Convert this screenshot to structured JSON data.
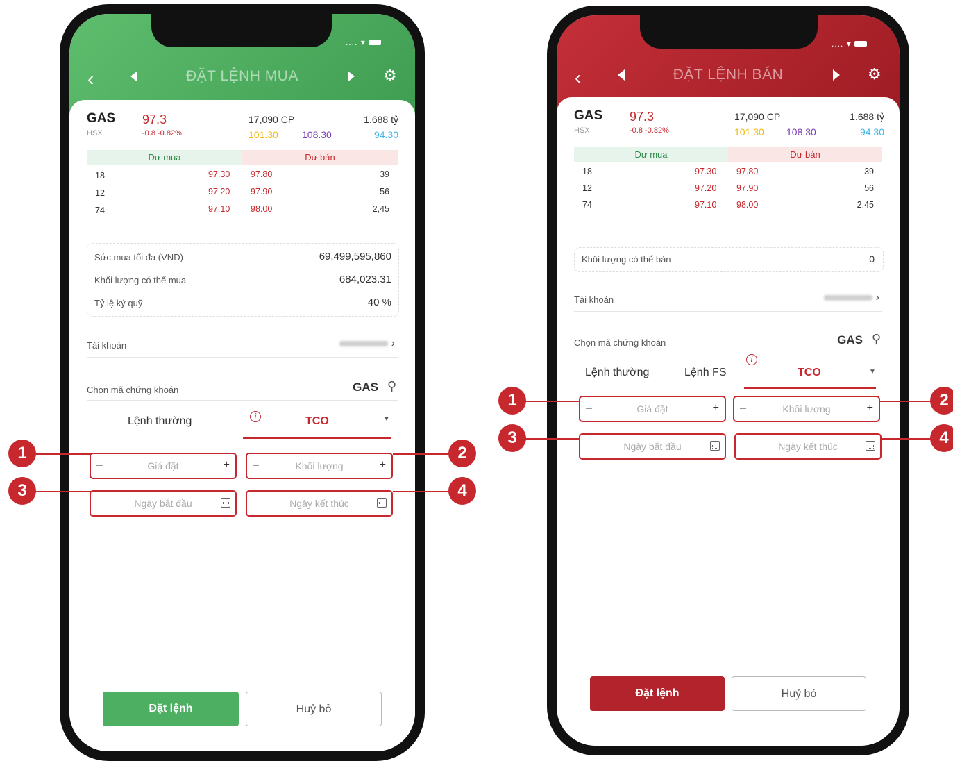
{
  "buy": {
    "status_dots": "....",
    "title": "ĐẶT LỆNH MUA",
    "stock": {
      "symbol": "GAS",
      "exchange": "HSX",
      "price": "97.3",
      "change": "-0.8  -0.82%",
      "volume": "17,090  CP",
      "value": "1.688  tỷ",
      "ref": "101.30",
      "ceiling": "108.30",
      "floor": "94.30"
    },
    "depth": {
      "buy_label": "Dư mua",
      "sell_label": "Dư bán",
      "rows": [
        {
          "bvol": "18",
          "bprice": "97.30",
          "sprice": "97.80",
          "svol": "39"
        },
        {
          "bvol": "12",
          "bprice": "97.20",
          "sprice": "97.90",
          "svol": "56"
        },
        {
          "bvol": "74",
          "bprice": "97.10",
          "sprice": "98.00",
          "svol": "2,45"
        }
      ]
    },
    "info": [
      {
        "label": "Sức mua tối đa (VND)",
        "value": "69,499,595,860"
      },
      {
        "label": "Khối lượng có thể mua",
        "value": "684,023.31"
      },
      {
        "label": "Tỷ lệ ký quỹ",
        "value": "40 %"
      }
    ],
    "account_label": "Tài khoản",
    "stock_select_label": "Chọn mã chứng khoán",
    "stock_select_value": "GAS",
    "tabs": [
      "Lệnh thường",
      "TCO"
    ],
    "price_placeholder": "Giá đặt",
    "qty_placeholder": "Khối lượng",
    "start_placeholder": "Ngày bắt đầu",
    "end_placeholder": "Ngày kết thúc",
    "submit": "Đặt lệnh",
    "cancel": "Huỷ bỏ",
    "colors": {
      "header": "#4caf62",
      "submit": "#4caf62"
    }
  },
  "sell": {
    "status_dots": "....",
    "title": "ĐẶT LỆNH BÁN",
    "stock": {
      "symbol": "GAS",
      "exchange": "HSX",
      "price": "97.3",
      "change": "-0.8  -0.82%",
      "volume": "17,090  CP",
      "value": "1.688  tỷ",
      "ref": "101.30",
      "ceiling": "108.30",
      "floor": "94.30"
    },
    "depth": {
      "buy_label": "Dư mua",
      "sell_label": "Dư bán",
      "rows": [
        {
          "bvol": "18",
          "bprice": "97.30",
          "sprice": "97.80",
          "svol": "39"
        },
        {
          "bvol": "12",
          "bprice": "97.20",
          "sprice": "97.90",
          "svol": "56"
        },
        {
          "bvol": "74",
          "bprice": "97.10",
          "sprice": "98.00",
          "svol": "2,45"
        }
      ]
    },
    "sellable_label": "Khối lượng có thể bán",
    "sellable_value": "0",
    "account_label": "Tài khoản",
    "stock_select_label": "Chọn mã chứng khoán",
    "stock_select_value": "GAS",
    "tabs": [
      "Lệnh thường",
      "Lệnh FS",
      "TCO"
    ],
    "price_placeholder": "Giá đặt",
    "qty_placeholder": "Khối lượng",
    "start_placeholder": "Ngày bắt đầu",
    "end_placeholder": "Ngày kết thúc",
    "submit": "Đặt lệnh",
    "cancel": "Huỷ bỏ",
    "colors": {
      "header": "#b3232c",
      "submit": "#b3232c"
    }
  },
  "callouts": [
    "1",
    "2",
    "3",
    "4"
  ],
  "icons": {
    "back": "chevron-left-icon",
    "prev": "triangle-left-icon",
    "next": "triangle-right-icon",
    "settings": "gear-icon",
    "search": "search-icon",
    "info": "info-icon",
    "dropdown": "caret-down-icon",
    "calendar": "calendar-icon",
    "chevron": "chevron-right-icon"
  }
}
